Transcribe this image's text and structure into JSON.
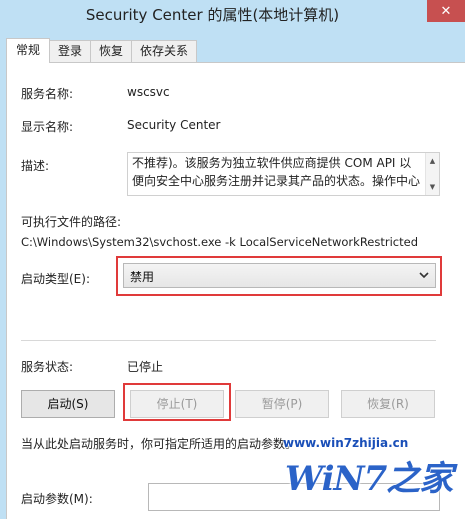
{
  "window": {
    "title": "Security Center 的属性(本地计算机)",
    "close_glyph": "✕"
  },
  "tabs": [
    {
      "label": "常规",
      "active": true
    },
    {
      "label": "登录",
      "active": false
    },
    {
      "label": "恢复",
      "active": false
    },
    {
      "label": "依存关系",
      "active": false
    }
  ],
  "general": {
    "service_name_label": "服务名称:",
    "service_name_value": "wscsvc",
    "display_name_label": "显示名称:",
    "display_name_value": "Security Center",
    "description_label": "描述:",
    "description_text": "不推荐)。该服务为独立软件供应商提供 COM API 以便向安全中心服务注册并记录其产品的状态。操作中心",
    "exe_path_label": "可执行文件的路径:",
    "exe_path_value": "C:\\Windows\\System32\\svchost.exe -k LocalServiceNetworkRestricted",
    "startup_type_label": "启动类型(E):",
    "startup_type_value": "禁用",
    "service_status_label": "服务状态:",
    "service_status_value": "已停止",
    "buttons": {
      "start": "启动(S)",
      "stop": "停止(T)",
      "pause": "暂停(P)",
      "resume": "恢复(R)"
    },
    "start_params_hint": "当从此处启动服务时，你可指定所适用的启动参数。",
    "start_params_label": "启动参数(M):",
    "start_params_value": ""
  },
  "watermark": {
    "url": "www.win7zhijia.cn",
    "logo": "WiN7之家"
  },
  "colors": {
    "title_bar": "#bfe0f4",
    "close_button": "#c75050",
    "highlight_outline": "#e03a3a"
  }
}
